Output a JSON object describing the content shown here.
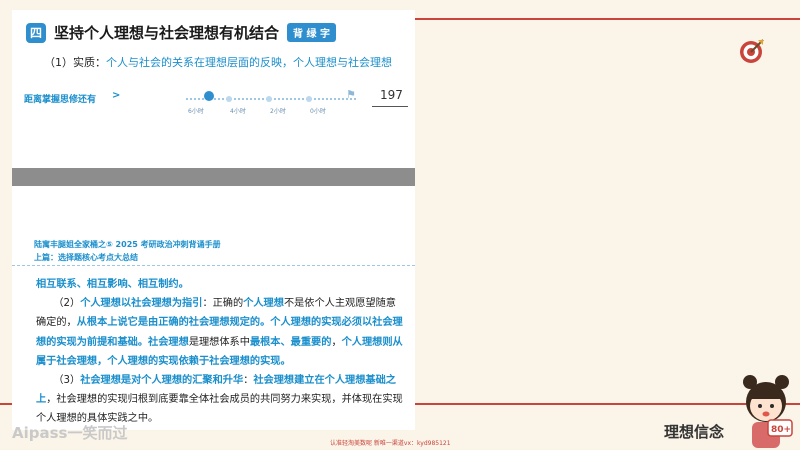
{
  "slide": {
    "section_number": "四",
    "heading_title": "坚持个人理想与社会理想有机结合",
    "recite_tag": "背 绿 字",
    "subtitle_prefix": "（1）实质：",
    "subtitle_text": "个人与社会的关系在理想层面的反映，个人理想与社会理想"
  },
  "progress": {
    "label": "距离掌握思修还有",
    "arrow": ">",
    "ticks": [
      "6小时",
      "4小时",
      "2小时",
      "0小时"
    ],
    "count": "197"
  },
  "book": {
    "title": "陆寓丰腿姐全家桶之⑤  2025 考研政治冲刺背诵手册",
    "subtitle": "上篇：选择题核心考点大总结"
  },
  "body": {
    "line1": "相互联系、相互影响、相互制约。",
    "p2_num": "（2）",
    "p2_hl1": "个人理想以社会理想为指引",
    "p2_t1": "：正确的",
    "p2_hl2": "个人理想",
    "p2_t2": "不是依个人主观愿望随意确定的，",
    "p2_hl3": "从根本上说它是由正确的社会理想规定的。个人理想的实现必须以社会理想的实现为前提和基础。社会理想",
    "p2_t3": "是理想体系中",
    "p2_hl4": "最根本、最重要的",
    "p2_t4": "，",
    "p2_hl5": "个人理想则从属于社会理想，个人理想的实现依赖于社会理想的实现。",
    "p3_num": "（3）",
    "p3_hl1": "社会理想是对个人理想的汇聚和升华",
    "p3_t1": "：",
    "p3_hl2": "社会理想建立在个人理想基础之上",
    "p3_t2": "，社会理想的实现归根到底要靠全体社会成员的共同努力来实现，并体现在实现个人理想的具体实践之中。"
  },
  "footer": {
    "brand": "Aipass一笑而过",
    "course": "理想信念",
    "watermark": "认准轻淘美数呢 新唯一渠道vx：kyd985121"
  },
  "colors": {
    "accent_red": "#c9453c",
    "highlight_blue": "#1b8fcc"
  },
  "icons": [
    "target-icon",
    "avatar"
  ]
}
